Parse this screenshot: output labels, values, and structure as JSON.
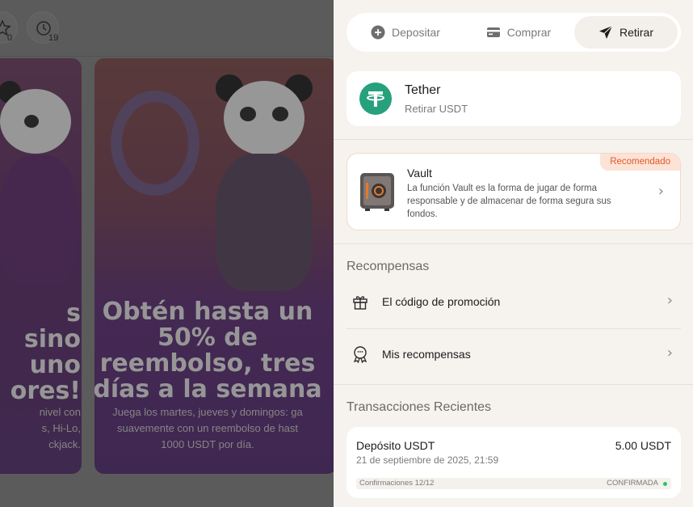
{
  "background": {
    "header": {
      "favorites_count": "0",
      "history_count": "19"
    },
    "banner_left": {
      "lines": [
        "s",
        "sino",
        "uno",
        "ores!"
      ],
      "sub": [
        "nivel con",
        "s, Hi-Lo,",
        "ckjack."
      ]
    },
    "banner_right": {
      "lines": [
        "Obtén hasta un",
        "50% de",
        "reembolso, tres",
        "días a la semana"
      ],
      "sub": [
        "Juega los martes, jueves y domingos: ga",
        "suavemente con un reembolso de hast",
        "1000 USDT por día."
      ]
    }
  },
  "panel": {
    "tabs": [
      {
        "label": "Depositar",
        "icon": "plus-circle-icon",
        "active": false
      },
      {
        "label": "Comprar",
        "icon": "card-icon",
        "active": false
      },
      {
        "label": "Retirar",
        "icon": "send-icon",
        "active": true
      }
    ],
    "currency": {
      "title": "Tether",
      "subtitle": "Retirar USDT",
      "icon": "tether-logo",
      "color": "#26a17b"
    },
    "vault": {
      "badge": "Recomendado",
      "title": "Vault",
      "description": "La función Vault es la forma de jugar de forma responsable y de almacenar de forma segura sus fondos."
    },
    "rewards": {
      "title": "Recompensas",
      "items": [
        {
          "label": "El código de promoción",
          "icon": "gift-icon"
        },
        {
          "label": "Mis recompensas",
          "icon": "reward-badge-icon"
        }
      ]
    },
    "transactions": {
      "title": "Transacciones Recientes",
      "items": [
        {
          "title": "Depósito USDT",
          "amount": "5.00 USDT",
          "date": "21 de septiembre de 2025, 21:59",
          "confirmations": "Confirmaciones 12/12",
          "status": "CONFIRMADA"
        }
      ]
    }
  },
  "colors": {
    "accent": "#e0592a",
    "badge_bg": "#fde3d6",
    "status_ok": "#27c46a",
    "panel_bg": "#f6f2ee"
  }
}
